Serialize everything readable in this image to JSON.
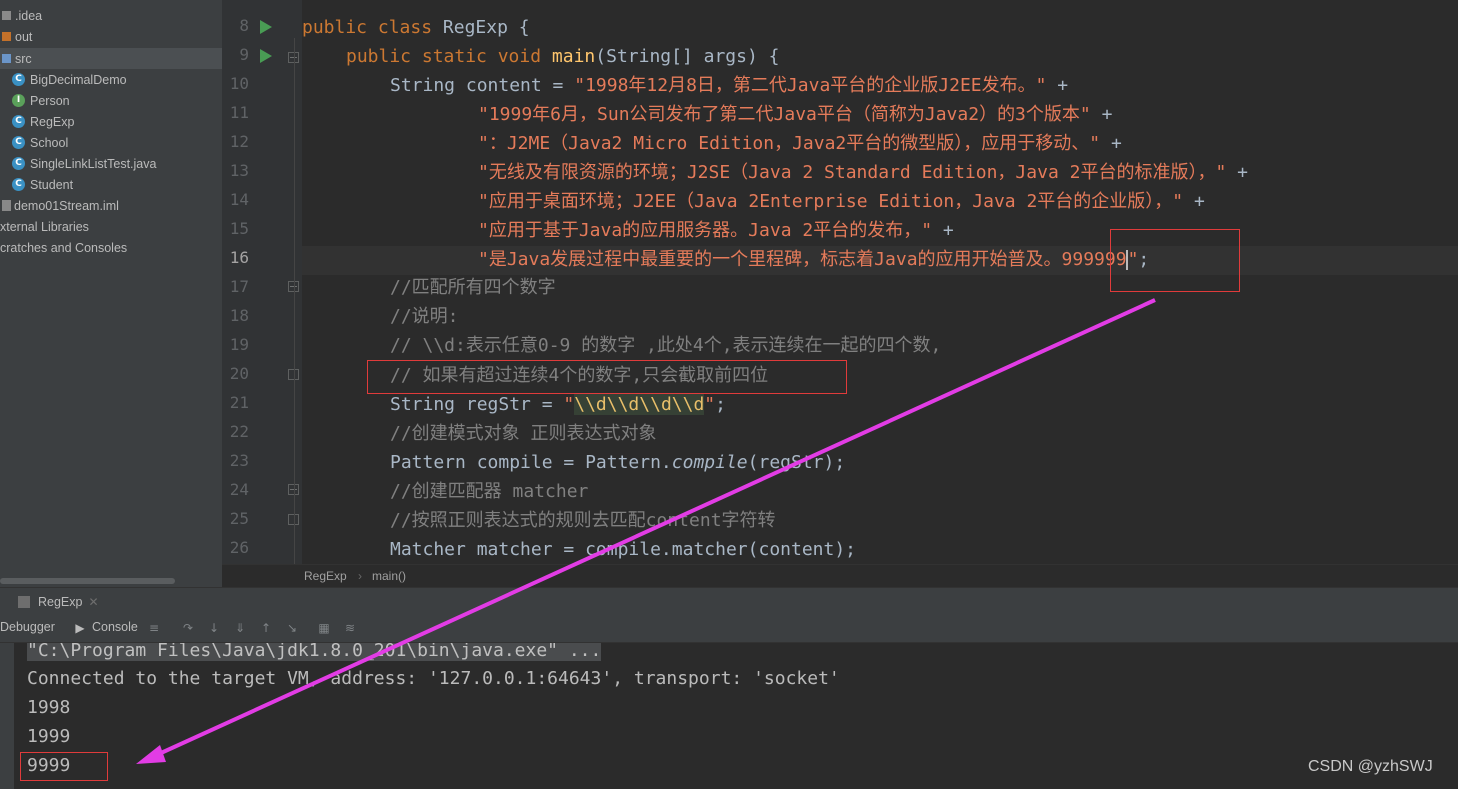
{
  "project_tree": {
    "items": [
      {
        "label": ".idea",
        "kind": "folder",
        "color": "#8a8a8a"
      },
      {
        "label": "out",
        "kind": "folder",
        "color": "#c3712a"
      },
      {
        "label": "src",
        "kind": "folder",
        "color": "#6b95c8",
        "selected": true
      },
      {
        "label": "BigDecimalDemo",
        "kind": "class",
        "icon_letter": "C",
        "color": "#3a91c4"
      },
      {
        "label": "Person",
        "kind": "interface",
        "icon_letter": "I",
        "color": "#5aa05a"
      },
      {
        "label": "RegExp",
        "kind": "class",
        "icon_letter": "C",
        "color": "#3a91c4"
      },
      {
        "label": "School",
        "kind": "class",
        "icon_letter": "C",
        "color": "#3a91c4"
      },
      {
        "label": "SingleLinkListTest.java",
        "kind": "class",
        "icon_letter": "C",
        "color": "#3a91c4"
      },
      {
        "label": "Student",
        "kind": "class",
        "icon_letter": "C",
        "color": "#3a91c4"
      },
      {
        "label": "demo01Stream.iml",
        "kind": "file",
        "color": "#8a8a8a"
      },
      {
        "label": "xternal Libraries",
        "kind": "root"
      },
      {
        "label": "cratches and Consoles",
        "kind": "root"
      }
    ]
  },
  "editor": {
    "line_numbers": [
      "8",
      "9",
      "10",
      "11",
      "12",
      "13",
      "14",
      "15",
      "16",
      "17",
      "18",
      "19",
      "20",
      "21",
      "22",
      "23",
      "24",
      "25",
      "26"
    ],
    "current_line": "16",
    "code": {
      "l8": {
        "kw": "public class ",
        "name": "RegExp",
        "rest": " {"
      },
      "l9": {
        "kw": "public static void ",
        "name": "main",
        "rest": "(String[] args) {"
      },
      "l10": {
        "type": "String ",
        "var": "content = ",
        "str": "\"1998年12月8日，第二代Java平台的企业版J2EE发布。\"",
        "rest": " +"
      },
      "l11": {
        "str": "\"1999年6月，Sun公司发布了第二代Java平台（简称为Java2）的3个版本\"",
        "rest": " +"
      },
      "l12": {
        "str": "\"：J2ME（Java2 Micro Edition，Java2平台的微型版），应用于移动、\"",
        "rest": " +"
      },
      "l13": {
        "str": "\"无线及有限资源的环境；J2SE（Java 2 Standard Edition，Java 2平台的标准版），\"",
        "rest": " +"
      },
      "l14": {
        "str": "\"应用于桌面环境；J2EE（Java 2Enterprise Edition，Java 2平台的企业版），\"",
        "rest": " +"
      },
      "l15": {
        "str": "\"应用于基于Java的应用服务器。Java 2平台的发布，\"",
        "rest": " +"
      },
      "l16": {
        "str": "\"是Java发展过程中最重要的一个里程碑，标志着Java的应用开始普及。999999",
        "str_end": "\"",
        "rest": ";"
      },
      "l17": {
        "comment": "//匹配所有四个数字"
      },
      "l18": {
        "comment": "//说明:"
      },
      "l19": {
        "comment": "// \\\\d:表示任意0-9 的数字 ,此处4个,表示连续在一起的四个数,"
      },
      "l20": {
        "comment": "// 如果有超过连续4个的数字,只会截取前四位"
      },
      "l21": {
        "type": "String ",
        "var": "regStr = ",
        "q1": "\"",
        "regex": "\\\\d\\\\d\\\\d\\\\d",
        "q2": "\"",
        "rest": ";"
      },
      "l22": {
        "comment": "//创建模式对象 正则表达式对象"
      },
      "l23": {
        "type": "Pattern ",
        "var": "compile = ",
        "cls": "Pattern.",
        "method": "compile",
        "rest": "(regStr);"
      },
      "l24": {
        "comment": "//创建匹配器 matcher"
      },
      "l25": {
        "comment": "//按照正则表达式的规则去匹配content字符转"
      },
      "l26": {
        "type": "Matcher ",
        "var": "matcher = compile.",
        "method": "matcher",
        "rest": "(content);"
      }
    }
  },
  "breadcrumb": {
    "class": "RegExp",
    "separator": "›",
    "method": "main()"
  },
  "run_panel": {
    "tab_label": "RegExp",
    "tabs": {
      "debugger": "Debugger",
      "console": "Console"
    },
    "toolbar_icons": [
      "menu-icon",
      "step-over-icon",
      "step-into-icon",
      "force-step-into-icon",
      "step-out-icon",
      "run-to-cursor-icon",
      "evaluate-icon",
      "trace-icon"
    ],
    "console_lines": [
      "\"C:\\Program Files\\Java\\jdk1.8.0_201\\bin\\java.exe\" ...",
      "Connected to the target VM, address: '127.0.0.1:64643', transport: 'socket'",
      "1998",
      "1999",
      "9999"
    ]
  },
  "annotation": {
    "arrow_color": "#e23ce5",
    "box_color": "#e03b3b"
  },
  "watermark": "CSDN @yzhSWJ"
}
